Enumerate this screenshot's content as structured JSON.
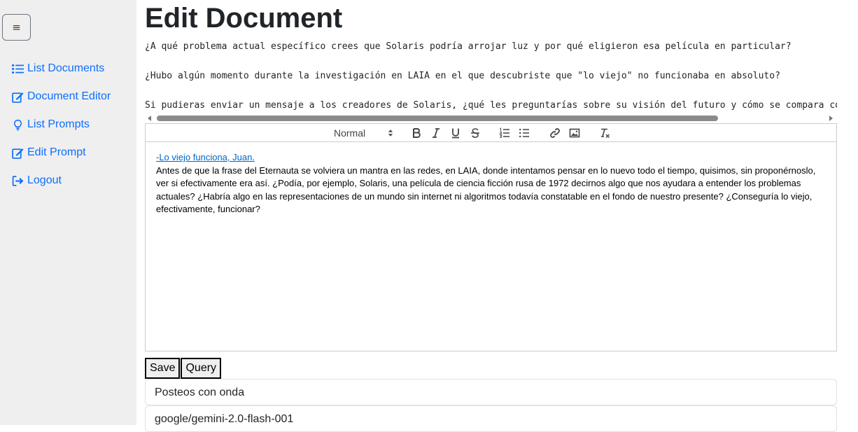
{
  "sidebar": {
    "toggle_label": "≡",
    "items": [
      {
        "label": "List Documents",
        "icon": "list-icon"
      },
      {
        "label": "Document Editor",
        "icon": "edit-icon"
      },
      {
        "label": "List Prompts",
        "icon": "lightbulb-icon"
      },
      {
        "label": "Edit Prompt",
        "icon": "edit-icon"
      },
      {
        "label": "Logout",
        "icon": "logout-icon"
      }
    ]
  },
  "page": {
    "title": "Edit Document"
  },
  "prompts": [
    "¿A qué problema actual específico crees que Solaris podría arrojar luz y por qué eligieron esa película en particular?",
    "¿Hubo algún momento durante la investigación en LAIA en el que descubriste que \"lo viejo\" no funcionaba en absoluto?",
    "Si pudieras enviar un mensaje a los creadores de Solaris, ¿qué les preguntarías sobre su visión del futuro y cómo se compara con"
  ],
  "editor": {
    "header_select": "Normal",
    "link_text": "-Lo viejo funciona, Juan.",
    "body_text": "Antes de que la frase del Eternauta se volviera un mantra en las redes, en LAIA, donde intentamos pensar en lo nuevo todo el tiempo, quisimos, sin proponérnoslo, ver si efectivamente era así. ¿Podía, por ejemplo, Solaris, una película de ciencia ficción rusa de 1972 decirnos algo que nos ayudara a entender los problemas actuales? ¿Habría algo en las representaciones de un mundo sin internet ni algoritmos todavía constatable en el fondo de nuestro presente? ¿Conseguría lo viejo, efectivamente, funcionar?"
  },
  "buttons": {
    "save": "Save",
    "query": "Query"
  },
  "selects": {
    "prompt": "Posteos con onda",
    "model": "google/gemini-2.0-flash-001"
  },
  "colors": {
    "link": "#0d6efd",
    "sidebar_bg": "#efefef"
  }
}
